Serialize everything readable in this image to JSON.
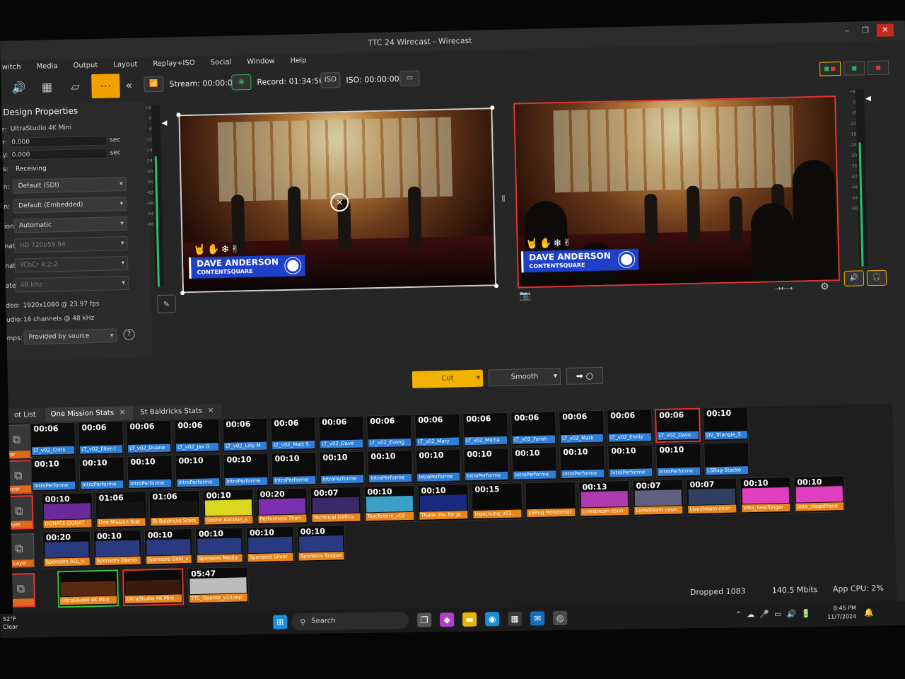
{
  "window": {
    "title": "TTC 24 Wirecast - Wirecast",
    "minimize": "‒",
    "restore": "❐",
    "close": "✕"
  },
  "menu": [
    "witch",
    "Media",
    "Output",
    "Layout",
    "Replay+ISO",
    "Social",
    "Window",
    "Help"
  ],
  "toolbar": {
    "stream": "Stream: 00:00:00",
    "record": "Record: 01:34:56",
    "iso": "ISO: 00:00:00",
    "iso_badge": "ISO"
  },
  "props": {
    "heading": "Design Properties",
    "device_label": "r:",
    "device": "UltraStudio 4K Mini",
    "r1_label": "r:",
    "r1_value": "0.000",
    "r1_unit": "sec",
    "r2_label": "y:",
    "r2_value": "0.000",
    "r2_unit": "sec",
    "status_label": "s:",
    "status": "Receiving",
    "select_1_label": "n:",
    "select_1": "Default (SDI)",
    "select_2_label": "n:",
    "select_2": "Default (Embedded)",
    "select_3_label": "ion:",
    "select_3": "Automatic",
    "select_4_label": "nat:",
    "select_4": "HD 720p59.94",
    "select_5_label": "nat:",
    "select_5": "YCbCr 4:2:2",
    "select_6_label": "ate:",
    "select_6": "48 kHz",
    "video_label": "deo:",
    "video": "1920x1080 @ 23.97 fps",
    "audio_label": "udio:",
    "audio": "16 channels @ 48 kHz",
    "timestamps_label": "mps:",
    "timestamps": "Provided by source",
    "help": "?"
  },
  "meters": {
    "ticks": [
      "+6",
      "0",
      "-6",
      "-12",
      "-18",
      "-24",
      "-30",
      "-36",
      "-42",
      "-48",
      "-54",
      "-60"
    ],
    "left_level": 0.72,
    "right_level": 0.7
  },
  "preview": {
    "name": "DAVE ANDERSON",
    "company": "CONTENTSQUARE",
    "doodles": "🤘✋❄✌"
  },
  "live": {
    "name": "DAVE ANDERSON",
    "company": "CONTENTSQUARE",
    "doodles": "🤘✋❄✌"
  },
  "transition": {
    "cut": "Cut",
    "smooth": "Smooth",
    "go": "➡ ○"
  },
  "tabs": [
    {
      "label": "ot List",
      "closable": false
    },
    {
      "label": "One Mission Stats",
      "closable": true
    },
    {
      "label": "St Baldricks Stats",
      "closable": true
    }
  ],
  "tab_close": "✕",
  "layers": [
    {
      "label": "yer"
    },
    {
      "label": "ayer"
    },
    {
      "label": "ayer"
    },
    {
      "label": "r Layer"
    },
    {
      "label": ""
    }
  ],
  "rows": [
    [
      {
        "dur": "00:06",
        "label": "LT_v02_Chris",
        "color": "blue"
      },
      {
        "dur": "00:06",
        "label": "LT_v02_Ellen I",
        "color": "blue"
      },
      {
        "dur": "00:06",
        "label": "LT_v02_Duane",
        "color": "blue"
      },
      {
        "dur": "00:06",
        "label": "LT_v02_Jax G",
        "color": "blue"
      },
      {
        "dur": "00:06",
        "label": "LT_v02_Lilly M",
        "color": "blue"
      },
      {
        "dur": "00:06",
        "label": "LT_v02_Matt S",
        "color": "blue"
      },
      {
        "dur": "00:06",
        "label": "LT_v02_Dave",
        "color": "blue"
      },
      {
        "dur": "00:06",
        "label": "LT_v02_Evong",
        "color": "blue"
      },
      {
        "dur": "00:06",
        "label": "LT_v02_Mary",
        "color": "blue"
      },
      {
        "dur": "00:06",
        "label": "LT_v02_Micha",
        "color": "blue"
      },
      {
        "dur": "00:06",
        "label": "LT_v02_Farah",
        "color": "blue"
      },
      {
        "dur": "00:06",
        "label": "LT_v02_Mark",
        "color": "blue"
      },
      {
        "dur": "00:06",
        "label": "LT_v02_Emily",
        "color": "blue"
      },
      {
        "dur": "00:06",
        "label": "LT_v02_Dave",
        "color": "blue",
        "state": "live"
      },
      {
        "dur": "00:10",
        "label": "DV_Triangle_S",
        "color": "blue"
      }
    ],
    [
      {
        "dur": "00:10",
        "label": "IntroPerforme",
        "color": "blue"
      },
      {
        "dur": "00:10",
        "label": "IntroPerforme",
        "color": "blue"
      },
      {
        "dur": "00:10",
        "label": "IntroPerforme",
        "color": "blue"
      },
      {
        "dur": "00:10",
        "label": "IntroPerforme",
        "color": "blue"
      },
      {
        "dur": "00:10",
        "label": "IntroPerforme",
        "color": "blue"
      },
      {
        "dur": "00:10",
        "label": "IntroPerforme",
        "color": "blue"
      },
      {
        "dur": "00:10",
        "label": "IntroPerforme",
        "color": "blue"
      },
      {
        "dur": "00:10",
        "label": "IntroPerforme",
        "color": "blue"
      },
      {
        "dur": "00:10",
        "label": "IntroPerforme",
        "color": "blue"
      },
      {
        "dur": "00:10",
        "label": "IntroPerforme",
        "color": "blue"
      },
      {
        "dur": "00:10",
        "label": "IntroPerforme",
        "color": "blue"
      },
      {
        "dur": "00:10",
        "label": "IntroPerforme",
        "color": "blue"
      },
      {
        "dur": "00:10",
        "label": "IntroPerforme",
        "color": "blue"
      },
      {
        "dur": "00:10",
        "label": "IntroPerforme",
        "color": "blue"
      },
      {
        "dur": "",
        "label": "LSBug-Stacke",
        "color": "blue"
      }
    ],
    [
      {
        "dur": "00:10",
        "label": "DONATE DONAT",
        "color": "orange",
        "thumb": "#6a2a9a"
      },
      {
        "dur": "01:06",
        "label": "One Mission Stat",
        "color": "orange",
        "thumb": "#141414"
      },
      {
        "dur": "01:06",
        "label": "St Baldricks Stats",
        "color": "orange",
        "thumb": "#141414"
      },
      {
        "dur": "00:10",
        "label": "Online Auction_v",
        "color": "orange",
        "thumb": "#d8d820"
      },
      {
        "dur": "00:20",
        "label": "Performers Than",
        "color": "orange",
        "thumb": "#7a30b0"
      },
      {
        "dur": "00:07",
        "label": "Technical Difficu",
        "color": "orange",
        "thumb": "#3a2a6a"
      },
      {
        "dur": "00:10",
        "label": "TextToVote_v02",
        "color": "orange",
        "thumb": "#3aa0c8"
      },
      {
        "dur": "00:10",
        "label": "Thank You for Jo",
        "color": "orange",
        "thumb": "#1a2a80"
      },
      {
        "dur": "00:15",
        "label": "logoLiving_v01.",
        "color": "orange",
        "thumb": "#0a0a0a"
      },
      {
        "dur": "",
        "label": "LSBug Horizontal",
        "color": "orange",
        "thumb": "#0a0a0a"
      },
      {
        "dur": "00:13",
        "label": "Livestream coun",
        "color": "orange",
        "thumb": "#b03ab0"
      },
      {
        "dur": "00:07",
        "label": "Livestream coun",
        "color": "orange",
        "thumb": "#606080"
      },
      {
        "dur": "00:07",
        "label": "Livestream coun",
        "color": "orange",
        "thumb": "#304060"
      },
      {
        "dur": "00:10",
        "label": "Vote_bestSinger",
        "color": "orange",
        "thumb": "#e040c0"
      },
      {
        "dur": "00:10",
        "label": "Vote_stagePrese",
        "color": "orange",
        "thumb": "#e040c0"
      }
    ],
    [
      {
        "dur": "00:20",
        "label": "Sponsors ALL_v",
        "color": "orange",
        "thumb": "#2a3a80"
      },
      {
        "dur": "00:10",
        "label": "Sponsors Diamo",
        "color": "orange",
        "thumb": "#2a3a80"
      },
      {
        "dur": "00:10",
        "label": "Sponsors Gold_v",
        "color": "orange",
        "thumb": "#2a3a80"
      },
      {
        "dur": "00:10",
        "label": "Sponsors Media",
        "color": "orange",
        "thumb": "#2a3a80"
      },
      {
        "dur": "00:10",
        "label": "Sponsors Silver",
        "color": "orange",
        "thumb": "#2a3a80"
      },
      {
        "dur": "00:10",
        "label": "Sponsors Suppor",
        "color": "orange",
        "thumb": "#2a3a80"
      }
    ],
    [
      {
        "dur": "",
        "label": "UltraStudio 4K Mini",
        "color": "orange",
        "thumb": "#5a2a10",
        "state": "preview"
      },
      {
        "dur": "",
        "label": "UltraStudio 4K Mini",
        "color": "orange",
        "thumb": "#3a1a0a",
        "state": "live"
      },
      {
        "dur": "05:47",
        "label": "TTC_Opener_v10.mp",
        "color": "orange",
        "thumb": "#bcbcbc"
      }
    ]
  ],
  "status": {
    "dropped": "Dropped 1083",
    "bitrate": "140.5 Mbits",
    "cpu": "App CPU:  2%"
  },
  "taskbar": {
    "temp": "52°F",
    "weather": "Clear",
    "search": "Search",
    "time": "8:45 PM",
    "date": "11/7/2024",
    "tray": "⌃☁🎤▭🔊🔋"
  }
}
